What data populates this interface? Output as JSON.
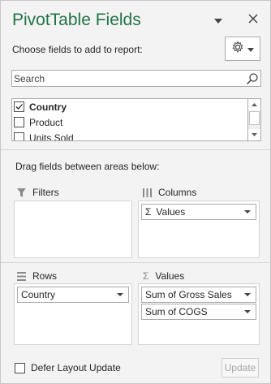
{
  "pane": {
    "title": "PivotTable Fields",
    "choose_label": "Choose fields to add to report:",
    "icons": {
      "dropdown": "chevron-down-icon",
      "close": "close-icon",
      "settings": "gear-icon",
      "search": "search-icon"
    }
  },
  "search": {
    "placeholder": "Search",
    "value": ""
  },
  "fields": [
    {
      "label": "Country",
      "checked": true
    },
    {
      "label": "Product",
      "checked": false
    },
    {
      "label": "Units Sold",
      "checked": false
    }
  ],
  "areas": {
    "drag_label": "Drag fields between areas below:",
    "filters": {
      "label": "Filters",
      "items": []
    },
    "columns": {
      "label": "Columns",
      "items": [
        "Values"
      ]
    },
    "rows": {
      "label": "Rows",
      "items": [
        "Country"
      ]
    },
    "values": {
      "label": "Values",
      "items": [
        "Sum of Gross Sales",
        "Sum of COGS"
      ]
    }
  },
  "footer": {
    "defer_label": "Defer Layout Update",
    "defer_checked": false,
    "update_label": "Update"
  },
  "colors": {
    "title": "#217346",
    "pane_bg": "#f3f3f3",
    "border": "#ababab"
  }
}
